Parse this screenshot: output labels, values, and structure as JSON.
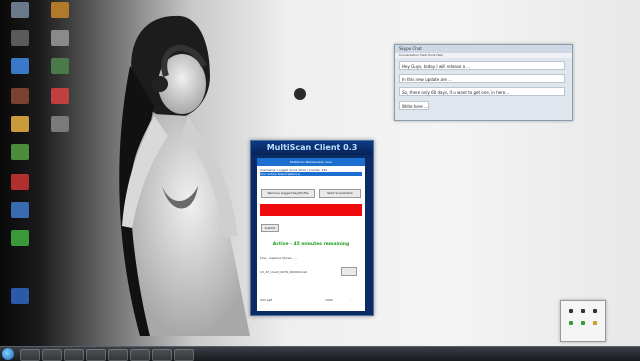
{
  "desktop": {
    "icons": [
      {
        "label": "",
        "color": "#6a7a8a"
      },
      {
        "label": "",
        "color": "#5a5a5a"
      },
      {
        "label": "",
        "color": "#3a78c8"
      },
      {
        "label": "",
        "color": "#7a4030"
      },
      {
        "label": "",
        "color": "#c89a3a"
      },
      {
        "label": "",
        "color": "#4a8c3a"
      },
      {
        "label": "",
        "color": "#b03030"
      },
      {
        "label": "",
        "color": "#3a6ab0"
      },
      {
        "label": "",
        "color": "#3a9a3a"
      },
      {
        "label": "",
        "color": "#2a5aa8"
      },
      {
        "label": "",
        "color": "#b07a2a"
      },
      {
        "label": "",
        "color": "#8a8a8a"
      },
      {
        "label": "",
        "color": "#4a7a4a"
      },
      {
        "label": "",
        "color": "#c04040"
      },
      {
        "label": "",
        "color": "#7a7a7a"
      }
    ],
    "center_icon": {
      "label": "",
      "color": "#2a2a2a"
    }
  },
  "chat_window": {
    "title": "Skype Chat",
    "menu": "Conversation  View  Tools  Help",
    "lines": [
      "Hey Guys, today I will release a ...",
      "In this new update are ...",
      "So, there only 60 days, if u want to get one, in here...",
      "Write here ..."
    ]
  },
  "client_window": {
    "title": "MultiScan Client 0.3",
    "header_band": "MultiScan Membership Area",
    "info_line": "Username: Logged Since 2012 | Credits: 150",
    "info_line2": "Your Active Subscription(s)",
    "btn_left": "Remove Logged Key/Profile",
    "btn_right": "Start Scan/Check",
    "submit": "Submit",
    "status": "Active - 45 minutes remaining",
    "list_header": "Line  ·  Capture  Shows  ·  ...",
    "file_line": "13_23_client_0076_000000.bat",
    "footer_left": "Slot Left",
    "footer_mid": "1000",
    "footer_right": "...",
    "colors": {
      "title": "#bfe0ff",
      "status": "#1c9a1c",
      "bar": "#ef0b0b"
    }
  },
  "mini_window": {
    "label": ""
  },
  "taskbar": {
    "buttons": 8
  }
}
